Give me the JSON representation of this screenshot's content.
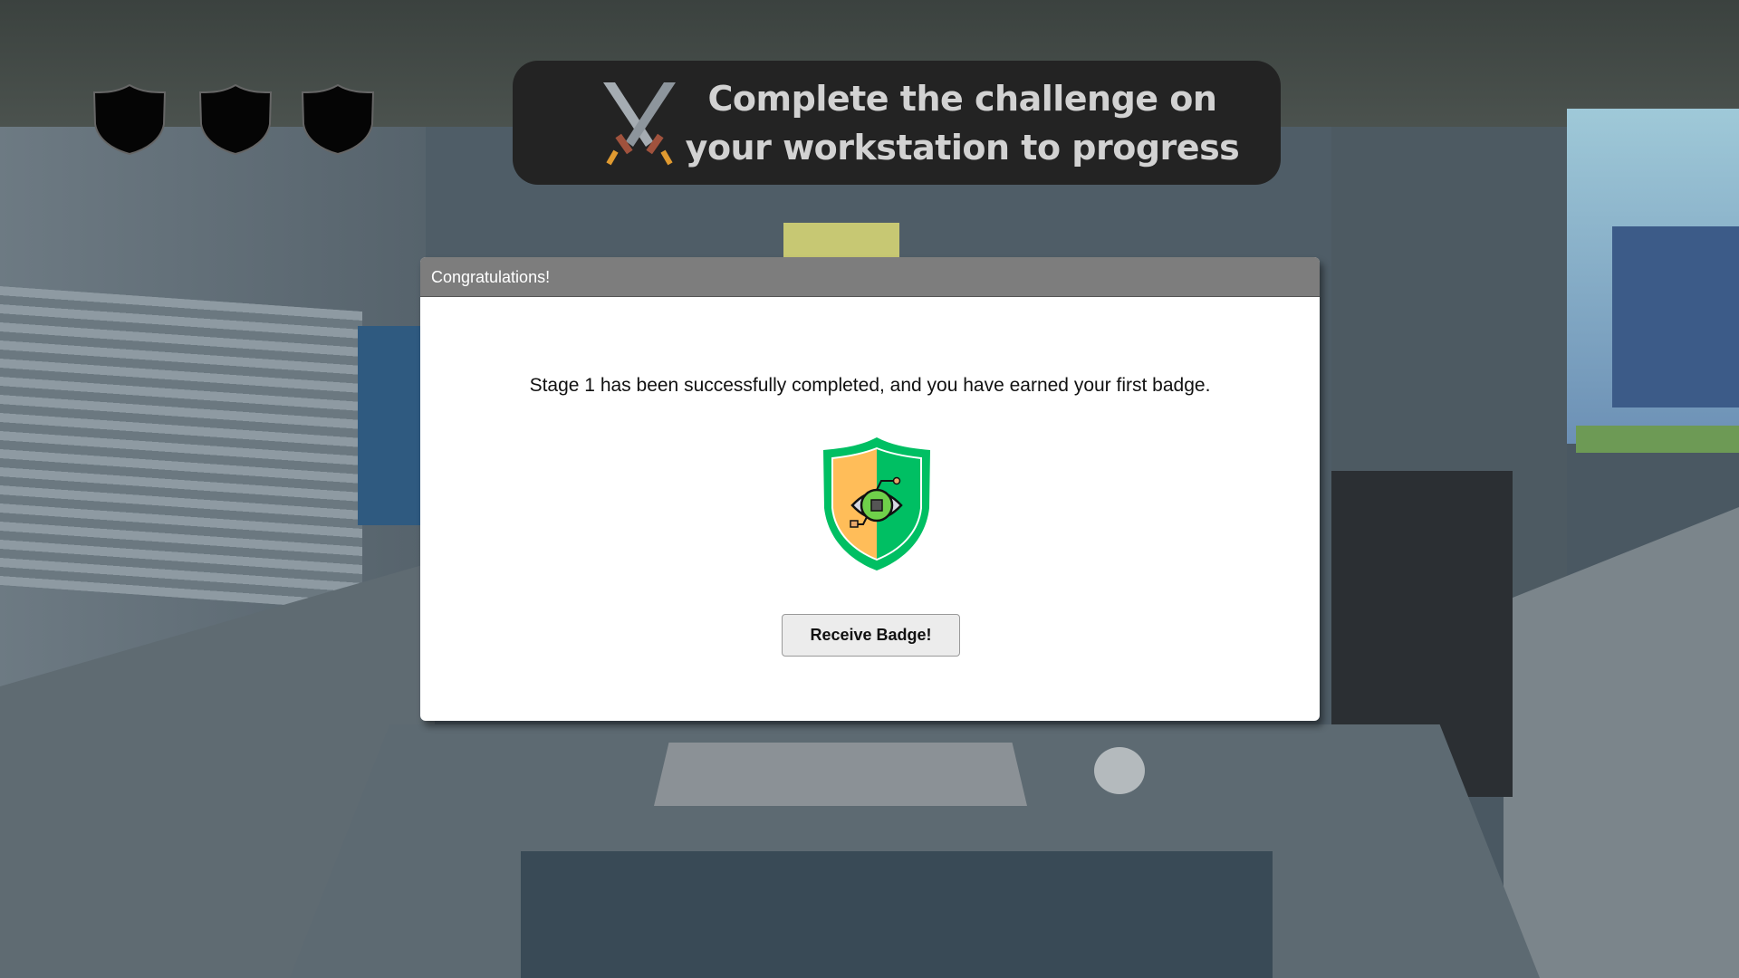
{
  "hud": {
    "badges": [
      {
        "state": "empty"
      },
      {
        "state": "empty"
      },
      {
        "state": "empty"
      }
    ],
    "objective_text": "Complete the challenge on your workstation to progress",
    "objective_icon": "crossed-swords-icon"
  },
  "dialog": {
    "title": "Congratulations!",
    "message": "Stage 1 has been successfully completed, and you have earned your first badge.",
    "badge_icon": "cyber-eye-shield-badge-icon",
    "button_label": "Receive Badge!"
  },
  "colors": {
    "badge_green": "#00bf63",
    "badge_orange": "#ffbd59",
    "banner_bg": "#232323",
    "dialog_header": "#7d7d7d"
  }
}
